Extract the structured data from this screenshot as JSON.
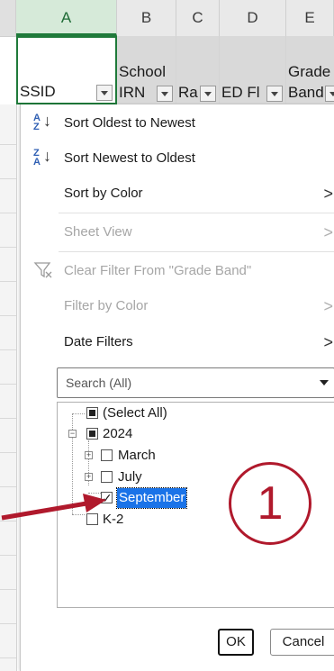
{
  "columns": [
    "A",
    "B",
    "C",
    "D",
    "E"
  ],
  "headers": {
    "a": "SSID",
    "b_line1": "School",
    "b_line2": "IRN",
    "c": "Ra",
    "d": "ED Fl",
    "e_line1": "Grade",
    "e_line2": "Band"
  },
  "menu": {
    "sort_oldest": "Sort Oldest to Newest",
    "sort_newest": "Sort Newest to Oldest",
    "sort_by_color": "Sort by Color",
    "sheet_view": "Sheet View",
    "clear_filter": "Clear Filter From \"Grade Band\"",
    "filter_by_color": "Filter by Color",
    "date_filters": "Date Filters",
    "search_placeholder": "Search (All)",
    "arrow_glyph": ">"
  },
  "tree": {
    "select_all": "(Select All)",
    "year": "2024",
    "march": "March",
    "july": "July",
    "september": "September",
    "k2": "K-2"
  },
  "buttons": {
    "ok": "OK",
    "cancel": "Cancel"
  },
  "annotation": {
    "number": "1"
  },
  "colors": {
    "accent_green": "#1f7a3a",
    "annotation_red": "#b0192c",
    "selection_blue": "#1a73e8"
  }
}
